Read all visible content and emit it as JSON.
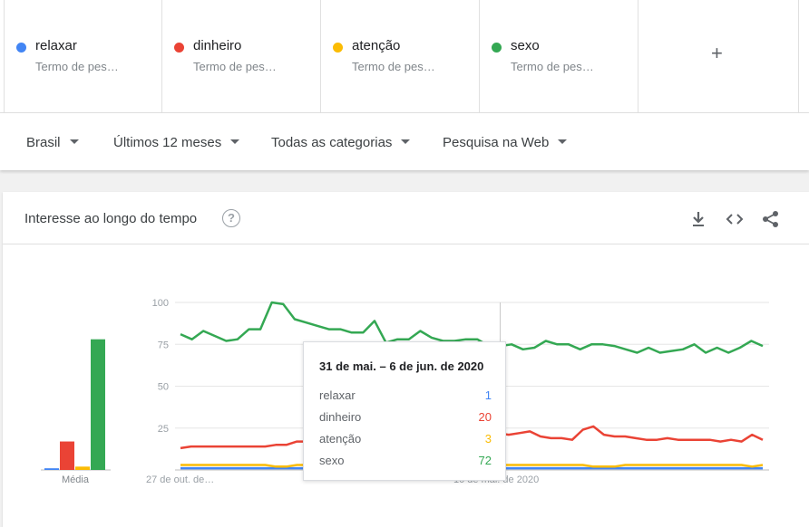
{
  "terms": [
    {
      "name": "relaxar",
      "sub": "Termo de pes…",
      "color": "#4285f4"
    },
    {
      "name": "dinheiro",
      "sub": "Termo de pes…",
      "color": "#ea4335"
    },
    {
      "name": "atenção",
      "sub": "Termo de pes…",
      "color": "#fbbc04"
    },
    {
      "name": "sexo",
      "sub": "Termo de pes…",
      "color": "#34a853"
    }
  ],
  "add_label": "+",
  "filters": {
    "region": "Brasil",
    "period": "Últimos 12 meses",
    "category": "Todas as categorias",
    "search_type": "Pesquisa na Web"
  },
  "card": {
    "title": "Interesse ao longo do tempo",
    "help_icon": "?",
    "icons": [
      "download-icon",
      "embed-icon",
      "share-icon"
    ]
  },
  "chart_data": {
    "type": "line",
    "y_ticks": [
      "100",
      "75",
      "50",
      "25"
    ],
    "ylim": [
      0,
      100
    ],
    "x_labels": [
      "27 de out. de…",
      "10 de mai. de 2020"
    ],
    "avg_label": "Média",
    "averages": {
      "relaxar": 1,
      "dinheiro": 17,
      "atenção": 2,
      "sexo": 78
    },
    "hover_index": 28,
    "series": [
      {
        "name": "relaxar",
        "color": "#4285f4",
        "values": [
          1,
          1,
          1,
          1,
          1,
          1,
          1,
          1,
          1,
          1,
          1,
          1,
          1,
          1,
          1,
          1,
          1,
          1,
          1,
          1,
          1,
          1,
          1,
          1,
          1,
          1,
          1,
          1,
          1,
          1,
          1,
          1,
          1,
          1,
          1,
          1,
          1,
          1,
          1,
          1,
          1,
          1,
          1,
          1,
          1,
          1,
          1,
          1,
          1,
          1,
          1,
          1
        ]
      },
      {
        "name": "dinheiro",
        "color": "#ea4335",
        "values": [
          13,
          14,
          14,
          14,
          14,
          14,
          14,
          14,
          14,
          15,
          15,
          17,
          17,
          16,
          16,
          16,
          16,
          16,
          16,
          16,
          16,
          15,
          15,
          16,
          22,
          26,
          25,
          26,
          27,
          25,
          22,
          21,
          22,
          23,
          20,
          19,
          19,
          18,
          24,
          26,
          21,
          20,
          20,
          19,
          18,
          18,
          19,
          18,
          18,
          18,
          18,
          17,
          18,
          17,
          21,
          18
        ]
      },
      {
        "name": "atenção",
        "color": "#fbbc04",
        "values": [
          3,
          3,
          3,
          3,
          3,
          3,
          3,
          3,
          3,
          2,
          2,
          3,
          3,
          3,
          3,
          3,
          3,
          3,
          3,
          3,
          3,
          3,
          3,
          3,
          3,
          3,
          3,
          3,
          3,
          3,
          3,
          3,
          3,
          3,
          3,
          3,
          3,
          3,
          3,
          2,
          2,
          2,
          3,
          3,
          3,
          3,
          3,
          3,
          3,
          3,
          3,
          3,
          3,
          3,
          2,
          3
        ]
      },
      {
        "name": "sexo",
        "color": "#34a853",
        "values": [
          81,
          78,
          83,
          80,
          77,
          78,
          84,
          84,
          100,
          99,
          90,
          88,
          86,
          84,
          84,
          82,
          82,
          89,
          76,
          78,
          78,
          83,
          79,
          77,
          77,
          78,
          78,
          74,
          74,
          75,
          72,
          73,
          77,
          75,
          75,
          72,
          75,
          75,
          74,
          72,
          70,
          73,
          70,
          71,
          72,
          75,
          70,
          73,
          70,
          73,
          77,
          74
        ]
      }
    ]
  },
  "tooltip": {
    "title": "31 de mai. – 6 de jun. de 2020",
    "rows": [
      {
        "name": "relaxar",
        "value": "1",
        "color": "#4285f4"
      },
      {
        "name": "dinheiro",
        "value": "20",
        "color": "#ea4335"
      },
      {
        "name": "atenção",
        "value": "3",
        "color": "#fbbc04"
      },
      {
        "name": "sexo",
        "value": "72",
        "color": "#34a853"
      }
    ]
  }
}
